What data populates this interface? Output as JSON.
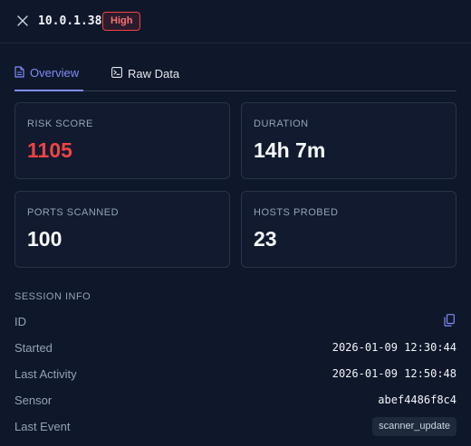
{
  "header": {
    "host": "10.0.1.38",
    "severity": "High"
  },
  "tabs": [
    {
      "label": "Overview",
      "icon": "document-icon",
      "active": true
    },
    {
      "label": "Raw Data",
      "icon": "terminal-icon",
      "active": false
    }
  ],
  "stats": {
    "risk_score": {
      "label": "RISK SCORE",
      "value": "1105"
    },
    "duration": {
      "label": "DURATION",
      "value": "14h 7m"
    },
    "ports_scanned": {
      "label": "PORTS SCANNED",
      "value": "100"
    },
    "hosts_probed": {
      "label": "HOSTS PROBED",
      "value": "23"
    }
  },
  "session_info": {
    "title": "SESSION INFO",
    "id": {
      "label": "ID"
    },
    "started": {
      "label": "Started",
      "value": "2026-01-09 12:30:44"
    },
    "last_activity": {
      "label": "Last Activity",
      "value": "2026-01-09 12:50:48"
    },
    "sensor": {
      "label": "Sensor",
      "value": "abef4486f8c4"
    },
    "last_event": {
      "label": "Last Event",
      "value": "scanner_update"
    }
  },
  "colors": {
    "background": "#0f172a",
    "accent": "#818cf8",
    "danger": "#ef4444"
  }
}
